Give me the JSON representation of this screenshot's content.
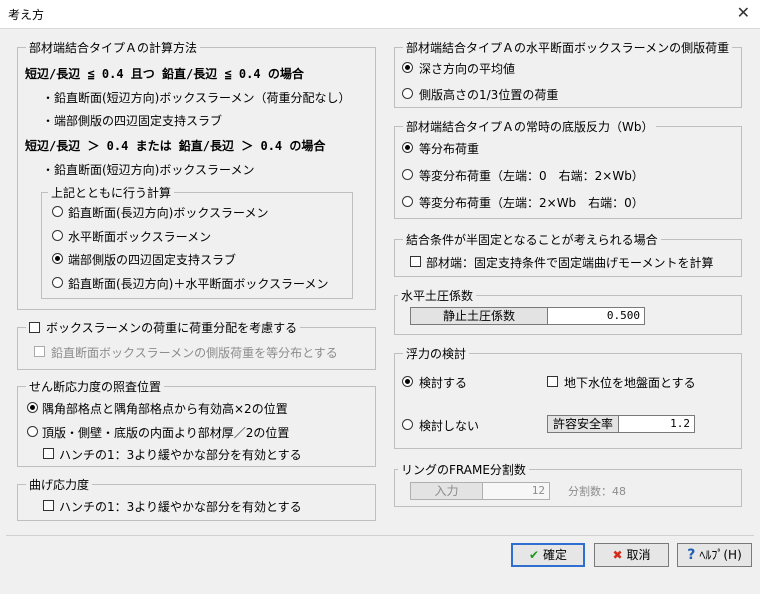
{
  "window": {
    "title": "考え方",
    "close_glyph": "✕"
  },
  "calc_method": {
    "label": "部材端結合タイプＡの計算方法",
    "cond1": "短辺/長辺 ≦ 0.4 且つ 鉛直/長辺 ≦ 0.4 の場合",
    "cond1_item1": "・鉛直断面(短辺方向)ボックスラーメン（荷重分配なし）",
    "cond1_item2": "・端部側版の四辺固定支持スラブ",
    "cond2": "短辺/長辺 ＞ 0.4 または 鉛直/長辺 ＞ 0.4 の場合",
    "cond2_item1": "・鉛直断面(短辺方向)ボックスラーメン"
  },
  "with_calc": {
    "label": "上記とともに行う計算",
    "options": [
      "鉛直断面(長辺方向)ボックスラーメン",
      "水平断面ボックスラーメン",
      "端部側版の四辺固定支持スラブ",
      "鉛直断面(長辺方向)＋水平断面ボックスラーメン"
    ],
    "selected": 2
  },
  "load_distribution": {
    "label": "ボックスラーメンの荷重に荷重分配を考慮する",
    "sub_label": "鉛直断面ボックスラーメンの側版荷重を等分布とする"
  },
  "shear": {
    "label": "せん断応力度の照査位置",
    "opt1": "隅角部格点と隅角部格点から有効高×2の位置",
    "opt2": "頂版・側壁・底版の内面より部材厚／2の位置",
    "haunch": "ハンチの1：3より緩やかな部分を有効とする"
  },
  "bending": {
    "label": "曲げ応力度",
    "haunch": "ハンチの1：3より緩やかな部分を有効とする"
  },
  "side_load": {
    "label": "部材端結合タイプＡの水平断面ボックスラーメンの側版荷重",
    "opt1": "深さ方向の平均値",
    "opt2": "側版高さの1/3位置の荷重"
  },
  "bottom_reaction": {
    "label": "部材端結合タイプＡの常時の底版反力（Wb）",
    "opt1": "等分布荷重",
    "opt2": "等変分布荷重（左端：0　右端：2×Wb）",
    "opt3": "等変分布荷重（左端：2×Wb　右端：0）"
  },
  "semi_fixed": {
    "label": "結合条件が半固定となることが考えられる場合",
    "check": "部材端：固定支持条件で固定端曲げモーメントを計算"
  },
  "earth_pressure": {
    "label": "水平土圧係数",
    "field_label": "静止土圧係数",
    "value": "0.500"
  },
  "buoyancy": {
    "label": "浮力の検討",
    "opt1": "検討する",
    "opt2": "検討しない",
    "ground_water": "地下水位を地盤面とする",
    "safety_label": "許容安全率",
    "safety_value": "1.2"
  },
  "ring_frame": {
    "label": "リングのFRAME分割数",
    "input_label": "入力",
    "input_value": "12",
    "count_text": "分割数：48"
  },
  "buttons": {
    "ok": "確定",
    "cancel": "取消",
    "help": "ﾍﾙﾌﾟ(H)",
    "ok_icon": "✔",
    "cancel_icon": "✖",
    "help_icon": "?"
  }
}
